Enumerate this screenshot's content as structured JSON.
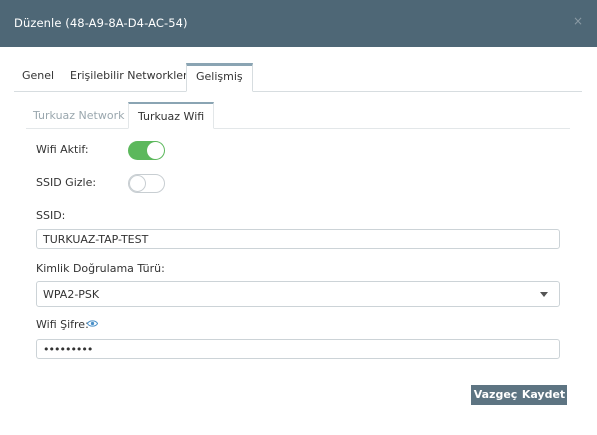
{
  "dialog": {
    "title": "Düzenle (48-A9-8A-D4-AC-54)",
    "close_glyph": "×"
  },
  "tabs": {
    "items": [
      "Genel",
      "Erişilebilir Networkler",
      "Gelişmiş"
    ],
    "active": "Gelişmiş"
  },
  "subtabs": {
    "items": [
      "Turkuaz Network",
      "Turkuaz Wifi"
    ],
    "active": "Turkuaz Wifi"
  },
  "form": {
    "wifi_active_label": "Wifi Aktif:",
    "wifi_active": true,
    "ssid_hidden_label": "SSID Gizle:",
    "ssid_hidden": false,
    "ssid_label": "SSID:",
    "ssid_value": "TURKUAZ-TAP-TEST",
    "auth_label": "Kimlik Doğrulama Türü:",
    "auth_value": "WPA2-PSK",
    "password_label": "Wifi Şifre:",
    "password_value": "•••••••••"
  },
  "buttons": {
    "cancel": "Vazgeç",
    "save": "Kaydet"
  },
  "colors": {
    "header": "#4e6776",
    "toggle_on": "#5cb85c",
    "button": "#5d7482",
    "tab_accent": "#8aa4b3"
  }
}
